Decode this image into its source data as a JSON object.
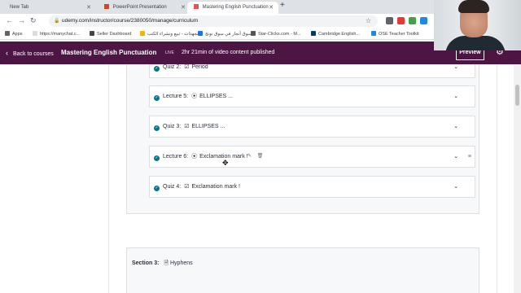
{
  "browser": {
    "tabs": [
      {
        "label": "New Tab",
        "active": false,
        "favicon_color": "#9aa0a6"
      },
      {
        "label": "PowerPoint Presentation",
        "active": false,
        "favicon_color": "#d24726"
      },
      {
        "label": "Mastering English Punctuation",
        "active": true,
        "favicon_color": "#ec5252"
      }
    ],
    "new_tab_symbol": "+",
    "url": "udemy.com/instructor/course/2380050/manage/curriculum",
    "bookmarks": [
      {
        "label": "Apps",
        "icon_color": "#5f6368"
      },
      {
        "label": "https://manychat.c...",
        "icon_color": "#ffffff"
      },
      {
        "label": "Seller Dashboard",
        "icon_color": "#444444"
      },
      {
        "label": "مجهدات - تبيع ونشراء الكتب",
        "icon_color": "#f5b400"
      },
      {
        "label": "سوق أنجار في سوق نونج",
        "icon_color": "#1a73e8"
      },
      {
        "label": "Star-Clicks.com - M...",
        "icon_color": "#555555"
      },
      {
        "label": "Cambridge English...",
        "icon_color": "#003c71"
      },
      {
        "label": "OSE Teacher Toolkit",
        "icon_color": "#1e88e5"
      }
    ]
  },
  "header": {
    "back_label": "Back to courses",
    "course_title": "Mastering English Punctuation",
    "status_badge": "LIVE",
    "published_text": "2hr 21min of video content published",
    "preview_label": "Preview",
    "accent_color": "#4d1544"
  },
  "curriculum": {
    "items": [
      {
        "kind": "Quiz 2:",
        "title": "Period",
        "type_icon": "checkbox-icon"
      },
      {
        "kind": "Lecture 5:",
        "title": "ELLIPSES ...",
        "type_icon": "play-circle-icon"
      },
      {
        "kind": "Quiz 3:",
        "title": "ELLIPSES ...",
        "type_icon": "checkbox-icon"
      },
      {
        "kind": "Lecture 6:",
        "title": "Exclamation mark !",
        "type_icon": "play-circle-icon",
        "hovered": true
      },
      {
        "kind": "Quiz 4:",
        "title": "Exclamation mark !",
        "type_icon": "checkbox-icon"
      }
    ],
    "section3": {
      "label": "Section 3:",
      "title": "Hyphens"
    }
  }
}
